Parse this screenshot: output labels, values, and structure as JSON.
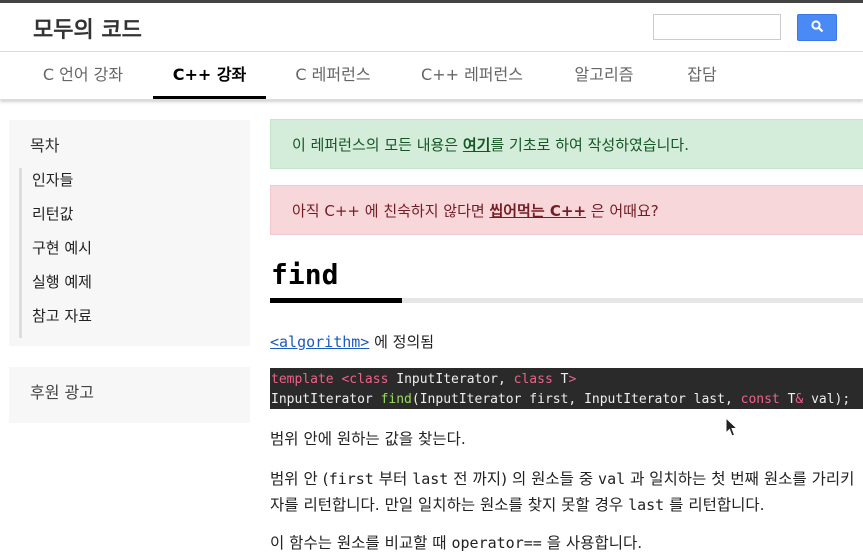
{
  "header": {
    "site_title": "모두의 코드"
  },
  "nav": {
    "tabs": [
      {
        "label": "C 언어 강좌",
        "active": false
      },
      {
        "label": "C++ 강좌",
        "active": true
      },
      {
        "label": "C 레퍼런스",
        "active": false
      },
      {
        "label": "C++ 레퍼런스",
        "active": false
      },
      {
        "label": "알고리즘",
        "active": false
      },
      {
        "label": "잡담",
        "active": false
      }
    ]
  },
  "sidebar": {
    "toc_title": "목차",
    "toc_items": [
      "인자들",
      "리턴값",
      "구현 예시",
      "실행 예제",
      "참고 자료"
    ],
    "ad_title": "후원 광고"
  },
  "alerts": {
    "success_prefix": "이 레퍼런스의 모든 내용은 ",
    "success_link": "여기",
    "success_suffix": "를 기초로 하여 작성하였습니다.",
    "danger_prefix": "아직 C++ 에 친숙하지 않다면 ",
    "danger_link": "씹어먹는 C++",
    "danger_suffix": " 은 어때요?"
  },
  "article": {
    "title": "find",
    "defined_link": "<algorithm>",
    "defined_suffix": " 에 정의됨",
    "code": {
      "line1": {
        "kw1": "template <",
        "kw2": "class",
        "t1": " InputIterator, ",
        "kw3": "class",
        "t2": " T",
        "kw4": ">"
      },
      "line2": {
        "t1": "InputIterator ",
        "fn": "find",
        "t2": "(InputIterator first, InputIterator last, ",
        "kw": "const",
        "t3": " T",
        "amp": "&",
        "t4": " val);"
      }
    },
    "p1": "범위 안에 원하는 값을 찾는다.",
    "p2_a": "범위 안 (",
    "p2_first": "first",
    "p2_b": " 부터 ",
    "p2_last": "last",
    "p2_c": " 전 까지) 의 원소들 중 ",
    "p2_val": "val",
    "p2_d": " 과 일치하는 첫 번째 원소를 가리키",
    "p2_line2_a": "자를 리턴합니다. 만일 일치하는 원소를 찾지 못할 경우 ",
    "p2_line2_last": "last",
    "p2_line2_b": " 를 리턴합니다.",
    "p3_a": "이 함수는 원소를 비교할 때 ",
    "p3_op": "operator==",
    "p3_b": " 을 사용합니다."
  },
  "colors": {
    "accent": "#4a8af4",
    "success_bg": "#d4edda",
    "danger_bg": "#f8d7da",
    "code_bg": "#2a2a2a"
  },
  "icons": {
    "search": "search-icon",
    "cursor": "mouse-cursor-icon"
  }
}
